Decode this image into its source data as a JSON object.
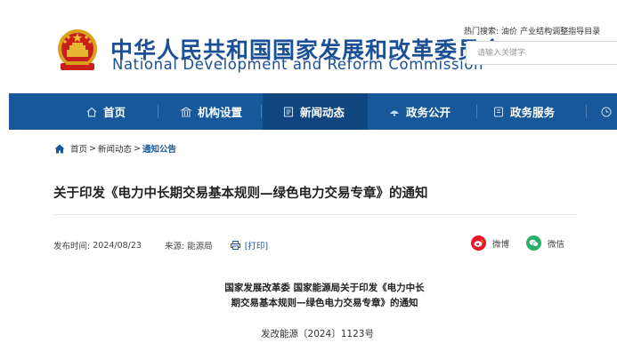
{
  "header": {
    "brand_cn": "中华人民共和国国家发展和改革委员会",
    "brand_en": "National Development and Reform Commission",
    "hot_label": "热门搜索:",
    "hot_links": [
      "油价",
      "产业结构调整指导目录"
    ],
    "search_placeholder": "请输入关键字"
  },
  "nav": {
    "items": [
      {
        "label": "首页",
        "icon": "home-icon"
      },
      {
        "label": "机构设置",
        "icon": "building-icon"
      },
      {
        "label": "新闻动态",
        "icon": "news-icon"
      },
      {
        "label": "政务公开",
        "icon": "open-icon"
      },
      {
        "label": "政务服务",
        "icon": "service-icon"
      }
    ],
    "active_index": 2
  },
  "breadcrumb": {
    "home": "首页",
    "level1": "新闻动态",
    "current": "通知公告",
    "separator": ">"
  },
  "article": {
    "title": "关于印发《电力中长期交易基本规则—绿色电力交易专章》的通知",
    "publish_label": "发布时间:",
    "publish_date": "2024/08/23",
    "source_label": "来源:",
    "source": "能源局",
    "print_label": "[打印]",
    "share": [
      {
        "label": "微博",
        "icon": "weibo-icon",
        "color": "#e6162d"
      },
      {
        "label": "微信",
        "icon": "wechat-icon",
        "color": "#2aae67"
      }
    ],
    "body_heading_line1": "国家发展改革委 国家能源局关于印发《电力中长",
    "body_heading_line2": "期交易基本规则—绿色电力交易专章》的通知",
    "doc_number": "发改能源〔2024〕1123号"
  },
  "colors": {
    "brand_blue": "#1b4f96",
    "nav_bg": "#17589a",
    "nav_active": "#0f4680"
  }
}
